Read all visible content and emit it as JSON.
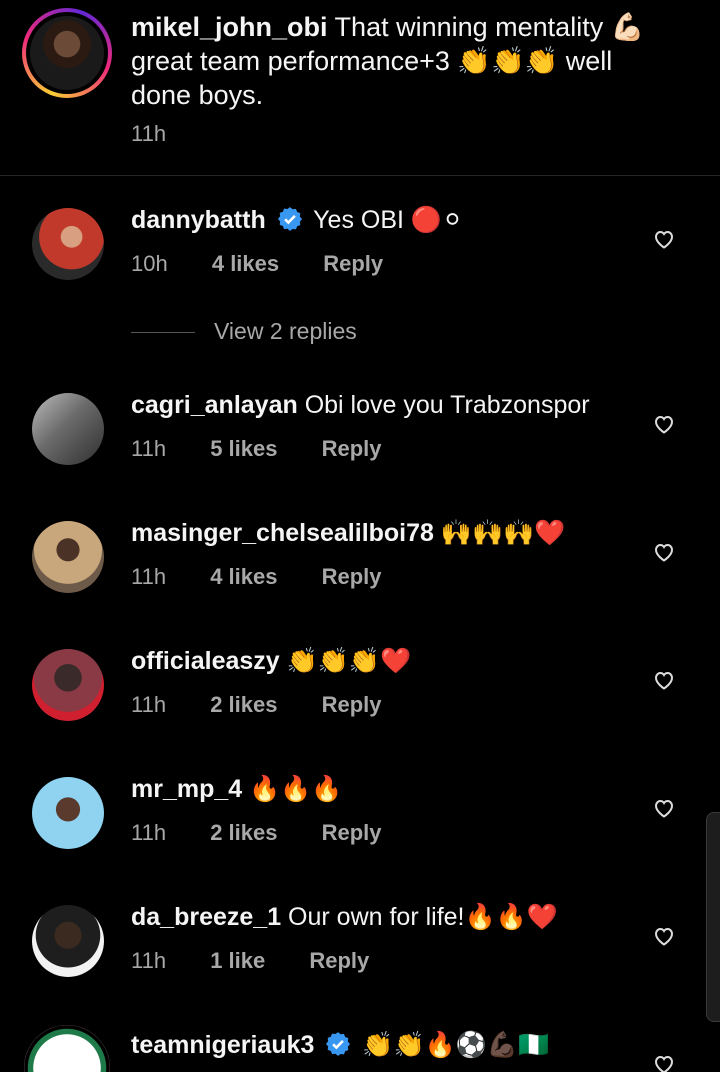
{
  "caption": {
    "username": "mikel_john_obi",
    "text": " That winning mentality 💪🏻 great team performance+3 👏👏👏 well done boys.",
    "time": "11h"
  },
  "comments": [
    {
      "username": "dannybatth",
      "verified": true,
      "text": " Yes OBI 🔴⚪",
      "time": "10h",
      "likes": "4 likes",
      "reply": "Reply",
      "avatar_colors": [
        "#c0392b",
        "#2a2a2a"
      ]
    },
    {
      "username": "cagri_anlayan",
      "verified": false,
      "text": " Obi love you Trabzonspor",
      "time": "11h",
      "likes": "5 likes",
      "reply": "Reply",
      "avatar_colors": [
        "#9a9a9a",
        "#3a3a3a"
      ]
    },
    {
      "username": "masinger_chelsealilboi78",
      "verified": false,
      "text": " 🙌🙌🙌❤️",
      "time": "11h",
      "likes": "4 likes",
      "reply": "Reply",
      "avatar_colors": [
        "#c9a77c",
        "#4b3a2c"
      ]
    },
    {
      "username": "officialeaszy",
      "verified": false,
      "text": " 👏👏👏❤️",
      "time": "11h",
      "likes": "2 likes",
      "reply": "Reply",
      "avatar_colors": [
        "#d04050",
        "#3b2230"
      ]
    },
    {
      "username": "mr_mp_4",
      "verified": false,
      "text": " 🔥🔥🔥",
      "time": "11h",
      "likes": "2 likes",
      "reply": "Reply",
      "avatar_colors": [
        "#8fd3f0",
        "#3f6b7f"
      ]
    },
    {
      "username": "da_breeze_1",
      "verified": false,
      "text": " Our own for life!🔥🔥❤️",
      "time": "11h",
      "likes": "1 like",
      "reply": "Reply",
      "avatar_colors": [
        "#f2f2f2",
        "#2a2a2a"
      ]
    },
    {
      "username": "teamnigeriauk3",
      "verified": true,
      "text": " 👏👏🔥⚽💪🏿🇳🇬",
      "time": "",
      "likes": "",
      "reply": "",
      "avatar_colors": [
        "#ffffff",
        "#1f7a4a"
      ]
    }
  ],
  "view_replies": {
    "label": "View 2 replies"
  },
  "colors": {
    "background": "#000000",
    "text": "#f5f5f5",
    "meta": "#a8a8a8",
    "verified": "#3897f0"
  },
  "icons": {
    "like": "heart-outline-icon",
    "verified": "verified-badge-icon"
  }
}
